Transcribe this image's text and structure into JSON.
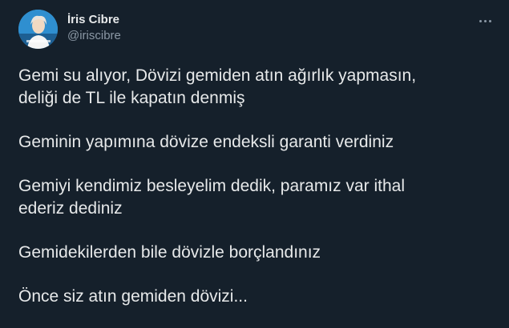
{
  "tweet": {
    "author": {
      "display_name": "İris Cibre",
      "handle": "@iriscibre"
    },
    "more_icon": "more-horizontal-icon",
    "paragraphs": [
      "Gemi su alıyor, Dövizi gemiden atın ağırlık yapmasın,\ndeliği de TL ile kapatın denmiş",
      "Geminin yapımına dövize endeksli garanti verdiniz",
      "Gemiyi kendimiz besleyelim dedik, paramız var ithal\nederiz dediniz",
      "Gemidekilerden bile dövizle borçlandınız",
      "Önce siz atın gemiden dövizi..."
    ]
  },
  "colors": {
    "background": "#15202b",
    "text": "#e7e9ea",
    "secondary_text": "#8b98a5"
  }
}
